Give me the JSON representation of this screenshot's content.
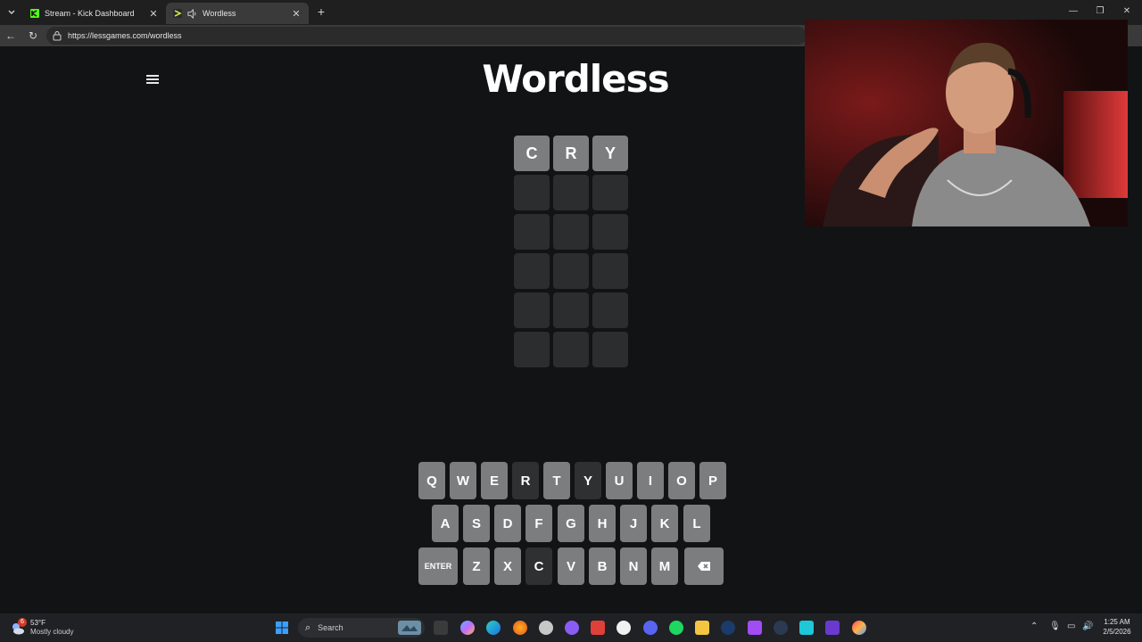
{
  "browser": {
    "tabs": [
      {
        "title": "Stream - Kick Dashboard",
        "active": false
      },
      {
        "title": "Wordless",
        "active": true
      }
    ],
    "url": "https://lessgames.com/wordless"
  },
  "page": {
    "brand": "Wordless",
    "grid": [
      [
        "C",
        "R",
        "Y"
      ],
      [
        "",
        "",
        ""
      ],
      [
        "",
        "",
        ""
      ],
      [
        "",
        "",
        ""
      ],
      [
        "",
        "",
        ""
      ],
      [
        "",
        "",
        ""
      ]
    ],
    "keyboard": {
      "row1": [
        {
          "label": "Q",
          "state": "default"
        },
        {
          "label": "W",
          "state": "default"
        },
        {
          "label": "E",
          "state": "default"
        },
        {
          "label": "R",
          "state": "used"
        },
        {
          "label": "T",
          "state": "default"
        },
        {
          "label": "Y",
          "state": "used"
        },
        {
          "label": "U",
          "state": "default"
        },
        {
          "label": "I",
          "state": "default"
        },
        {
          "label": "O",
          "state": "default"
        },
        {
          "label": "P",
          "state": "default"
        }
      ],
      "row2": [
        {
          "label": "A",
          "state": "default"
        },
        {
          "label": "S",
          "state": "default"
        },
        {
          "label": "D",
          "state": "default"
        },
        {
          "label": "F",
          "state": "default"
        },
        {
          "label": "G",
          "state": "default"
        },
        {
          "label": "H",
          "state": "default"
        },
        {
          "label": "J",
          "state": "default"
        },
        {
          "label": "K",
          "state": "default"
        },
        {
          "label": "L",
          "state": "default"
        }
      ],
      "row3": [
        {
          "label": "ENTER",
          "state": "default"
        },
        {
          "label": "Z",
          "state": "default"
        },
        {
          "label": "X",
          "state": "default"
        },
        {
          "label": "C",
          "state": "used"
        },
        {
          "label": "V",
          "state": "default"
        },
        {
          "label": "B",
          "state": "default"
        },
        {
          "label": "N",
          "state": "default"
        },
        {
          "label": "M",
          "state": "default"
        },
        {
          "label": "",
          "state": "default",
          "icon": "backspace-icon"
        }
      ]
    }
  },
  "taskbar": {
    "weather": {
      "temp": "53°F",
      "desc": "Mostly cloudy",
      "badge": "6"
    },
    "search_label": "Search",
    "clock": {
      "time": "1:25 AM",
      "date": "2/5/2026"
    }
  },
  "colors": {
    "page_bg": "#121314",
    "tile_filled": "#7c7d7e",
    "tile_empty": "#2b2d2e",
    "key_default": "#7c7d7e",
    "key_used": "#2f3031"
  }
}
